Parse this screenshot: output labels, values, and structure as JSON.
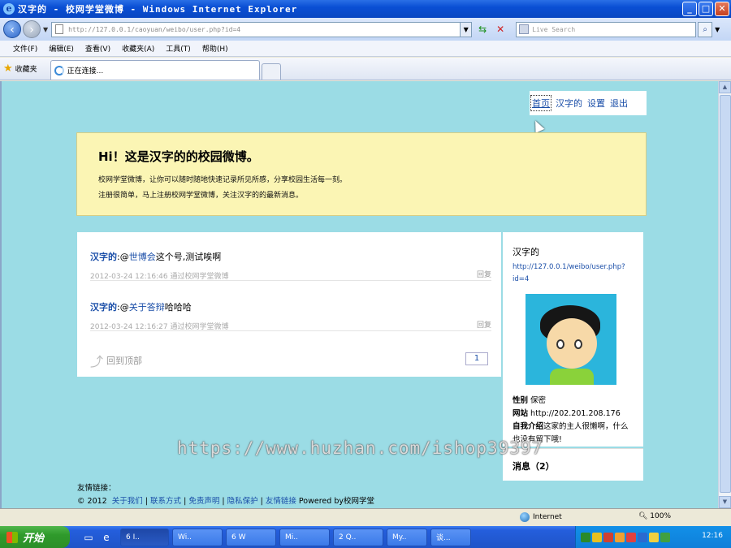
{
  "window": {
    "title": "汉字的 - 校网学堂微博 - Windows Internet Explorer",
    "controls": {
      "minimize": "_",
      "maximize": "□",
      "close": "✕"
    }
  },
  "addressbar": {
    "url": "http://127.0.0.1/caoyuan/weibo/user.php?id=4",
    "search_placeholder": "Live Search"
  },
  "menubar": {
    "items": [
      "文件(F)",
      "编辑(E)",
      "查看(V)",
      "收藏夹(A)",
      "工具(T)",
      "帮助(H)"
    ]
  },
  "favbar": {
    "favorites_label": "收藏夹",
    "tab_label": "正在连接..."
  },
  "page": {
    "topnav": [
      "首页",
      "汉字的",
      "设置",
      "退出"
    ],
    "welcome": {
      "title": "Hi！这是汉字的的校园微博。",
      "line1": "校网学堂微博，让你可以随时随地快速记录所见所感，分享校园生活每一刻。",
      "line2": "注册很简单，马上注册校网学堂微博，关注汉字的的最新消息。"
    },
    "posts": [
      {
        "author": "汉字的",
        "sep": ":",
        "at": "@",
        "mention": "世博会",
        "text": "这个号,测试唉啊",
        "meta": "2012-03-24 12:16:46 通过校网学堂微博",
        "reply": "回复"
      },
      {
        "author": "汉字的",
        "sep": ":",
        "at": "@",
        "mention": "关于答辩",
        "text": "哈哈哈",
        "meta": "2012-03-24 12:16:27 通过校网学堂微博",
        "reply": "回复"
      }
    ],
    "back_to_top": "回到顶部",
    "page_number": "1",
    "profile": {
      "name": "汉字的",
      "url": "http://127.0.0.1/weibo/user.php?id=4",
      "gender_label": "性别",
      "gender_value": "保密",
      "site_label": "网站",
      "site_value": "http://202.201.208.176",
      "intro_label": "自我介绍",
      "intro_value": "这家的主人很懒啊，什么也没有留下哦!"
    },
    "messages": "消息（2）",
    "watermark": "https://www.huzhan.com/ishop39397",
    "footer": {
      "links_title": "友情链接：",
      "copyright": "© 2012",
      "links": [
        "关于我们",
        "联系方式",
        "免责声明",
        "隐私保护",
        "友情链接"
      ],
      "separator": "|",
      "powered": "Powered by校网学堂"
    }
  },
  "statusbar": {
    "zone": "Internet",
    "zoom": "100%"
  },
  "taskbar": {
    "start": "开始",
    "tasks": [
      "6 I..",
      "Wi..",
      "6 W",
      "Mi..",
      "2 Q..",
      "My..",
      "谈..."
    ],
    "clock": "12:16"
  }
}
